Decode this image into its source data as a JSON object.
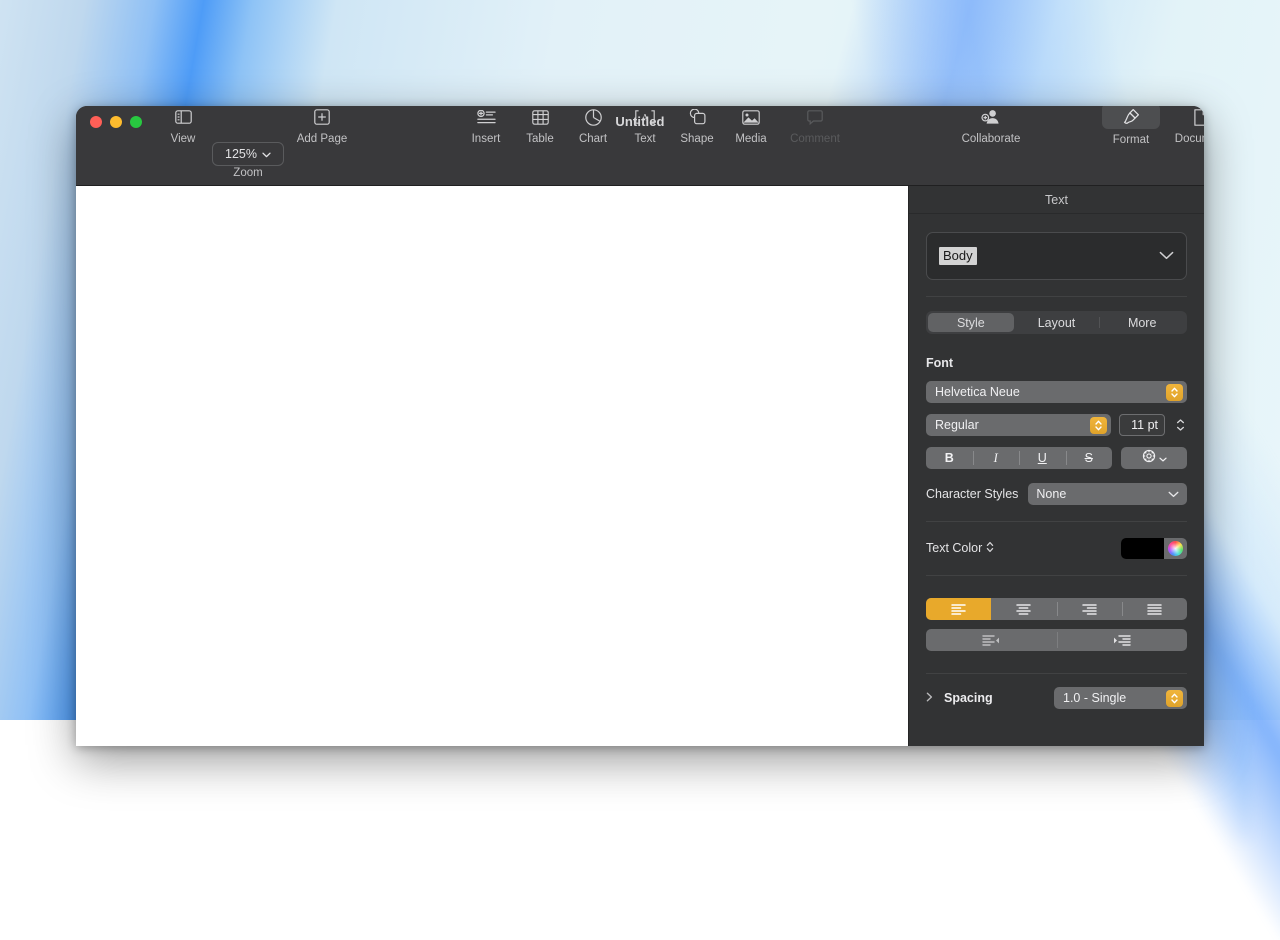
{
  "desktop": {
    "wallpaper_description": "blue light-streak gradient wallpaper",
    "accent_blue": "#4e9cf7",
    "base_light": "#e6f4f8"
  },
  "window": {
    "title": "Untitled",
    "traffic_lights": [
      {
        "name": "close",
        "color": "#ff5f57"
      },
      {
        "name": "minimize",
        "color": "#febc2e"
      },
      {
        "name": "zoom",
        "color": "#28c840"
      }
    ]
  },
  "toolbar": {
    "view": {
      "label": "View",
      "icon": "sidebar-icon"
    },
    "zoom": {
      "label": "Zoom",
      "value": "125%",
      "icon": "chevron-down-icon"
    },
    "add_page": {
      "label": "Add Page",
      "icon": "plus-square-icon"
    },
    "insert": {
      "label": "Insert",
      "icon": "insert-list-icon"
    },
    "table": {
      "label": "Table",
      "icon": "table-grid-icon"
    },
    "chart": {
      "label": "Chart",
      "icon": "pie-chart-icon"
    },
    "text": {
      "label": "Text",
      "icon": "text-box-icon"
    },
    "shape": {
      "label": "Shape",
      "icon": "shapes-icon"
    },
    "media": {
      "label": "Media",
      "icon": "photo-icon"
    },
    "comment": {
      "label": "Comment",
      "icon": "comment-bubble-icon",
      "enabled": false
    },
    "collaborate": {
      "label": "Collaborate",
      "icon": "add-person-icon"
    },
    "format": {
      "label": "Format",
      "icon": "paintbrush-icon",
      "active": true
    },
    "document": {
      "label": "Document",
      "icon": "document-page-icon"
    }
  },
  "inspector": {
    "header": "Text",
    "paragraph_style": {
      "value": "Body",
      "chevron": "chevron-down-icon"
    },
    "tabs": [
      {
        "label": "Style",
        "selected": true
      },
      {
        "label": "Layout",
        "selected": false
      },
      {
        "label": "More",
        "selected": false
      }
    ],
    "font": {
      "group_label": "Font",
      "family": "Helvetica Neue",
      "weight": "Regular",
      "size": "11 pt",
      "styles": [
        {
          "label": "B",
          "name": "bold"
        },
        {
          "label": "I",
          "name": "italic"
        },
        {
          "label": "U",
          "name": "underline"
        },
        {
          "label": "S",
          "name": "strikethrough"
        }
      ],
      "options_icon": "gear-icon"
    },
    "character_styles": {
      "label": "Character Styles",
      "value": "None"
    },
    "text_color": {
      "label": "Text Color",
      "swatch": "#000000",
      "sort_icon": "up-down-arrows-icon",
      "wheel_icon": "color-wheel-icon"
    },
    "alignment": [
      {
        "name": "align-left",
        "selected": true
      },
      {
        "name": "align-center",
        "selected": false
      },
      {
        "name": "align-right",
        "selected": false
      },
      {
        "name": "align-justify",
        "selected": false
      }
    ],
    "indent": [
      {
        "name": "decrease-indent",
        "selected": false
      },
      {
        "name": "increase-indent",
        "selected": false
      }
    ],
    "spacing": {
      "label": "Spacing",
      "value": "1.0 - Single",
      "disclosure": "disclosure-triangle-icon"
    },
    "accent_orange": "#e8a92b"
  }
}
